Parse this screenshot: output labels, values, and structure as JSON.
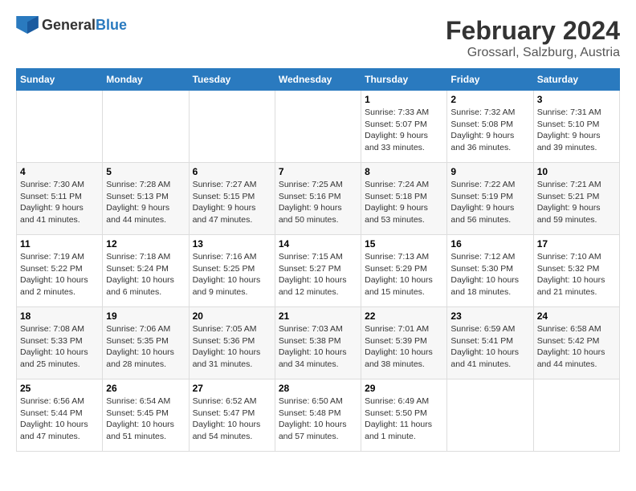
{
  "header": {
    "logo_general": "General",
    "logo_blue": "Blue",
    "title": "February 2024",
    "subtitle": "Grossarl, Salzburg, Austria"
  },
  "calendar": {
    "weekdays": [
      "Sunday",
      "Monday",
      "Tuesday",
      "Wednesday",
      "Thursday",
      "Friday",
      "Saturday"
    ],
    "weeks": [
      [
        {
          "day": "",
          "info": ""
        },
        {
          "day": "",
          "info": ""
        },
        {
          "day": "",
          "info": ""
        },
        {
          "day": "",
          "info": ""
        },
        {
          "day": "1",
          "sunrise": "Sunrise: 7:33 AM",
          "sunset": "Sunset: 5:07 PM",
          "daylight": "Daylight: 9 hours and 33 minutes."
        },
        {
          "day": "2",
          "sunrise": "Sunrise: 7:32 AM",
          "sunset": "Sunset: 5:08 PM",
          "daylight": "Daylight: 9 hours and 36 minutes."
        },
        {
          "day": "3",
          "sunrise": "Sunrise: 7:31 AM",
          "sunset": "Sunset: 5:10 PM",
          "daylight": "Daylight: 9 hours and 39 minutes."
        }
      ],
      [
        {
          "day": "4",
          "sunrise": "Sunrise: 7:30 AM",
          "sunset": "Sunset: 5:11 PM",
          "daylight": "Daylight: 9 hours and 41 minutes."
        },
        {
          "day": "5",
          "sunrise": "Sunrise: 7:28 AM",
          "sunset": "Sunset: 5:13 PM",
          "daylight": "Daylight: 9 hours and 44 minutes."
        },
        {
          "day": "6",
          "sunrise": "Sunrise: 7:27 AM",
          "sunset": "Sunset: 5:15 PM",
          "daylight": "Daylight: 9 hours and 47 minutes."
        },
        {
          "day": "7",
          "sunrise": "Sunrise: 7:25 AM",
          "sunset": "Sunset: 5:16 PM",
          "daylight": "Daylight: 9 hours and 50 minutes."
        },
        {
          "day": "8",
          "sunrise": "Sunrise: 7:24 AM",
          "sunset": "Sunset: 5:18 PM",
          "daylight": "Daylight: 9 hours and 53 minutes."
        },
        {
          "day": "9",
          "sunrise": "Sunrise: 7:22 AM",
          "sunset": "Sunset: 5:19 PM",
          "daylight": "Daylight: 9 hours and 56 minutes."
        },
        {
          "day": "10",
          "sunrise": "Sunrise: 7:21 AM",
          "sunset": "Sunset: 5:21 PM",
          "daylight": "Daylight: 9 hours and 59 minutes."
        }
      ],
      [
        {
          "day": "11",
          "sunrise": "Sunrise: 7:19 AM",
          "sunset": "Sunset: 5:22 PM",
          "daylight": "Daylight: 10 hours and 2 minutes."
        },
        {
          "day": "12",
          "sunrise": "Sunrise: 7:18 AM",
          "sunset": "Sunset: 5:24 PM",
          "daylight": "Daylight: 10 hours and 6 minutes."
        },
        {
          "day": "13",
          "sunrise": "Sunrise: 7:16 AM",
          "sunset": "Sunset: 5:25 PM",
          "daylight": "Daylight: 10 hours and 9 minutes."
        },
        {
          "day": "14",
          "sunrise": "Sunrise: 7:15 AM",
          "sunset": "Sunset: 5:27 PM",
          "daylight": "Daylight: 10 hours and 12 minutes."
        },
        {
          "day": "15",
          "sunrise": "Sunrise: 7:13 AM",
          "sunset": "Sunset: 5:29 PM",
          "daylight": "Daylight: 10 hours and 15 minutes."
        },
        {
          "day": "16",
          "sunrise": "Sunrise: 7:12 AM",
          "sunset": "Sunset: 5:30 PM",
          "daylight": "Daylight: 10 hours and 18 minutes."
        },
        {
          "day": "17",
          "sunrise": "Sunrise: 7:10 AM",
          "sunset": "Sunset: 5:32 PM",
          "daylight": "Daylight: 10 hours and 21 minutes."
        }
      ],
      [
        {
          "day": "18",
          "sunrise": "Sunrise: 7:08 AM",
          "sunset": "Sunset: 5:33 PM",
          "daylight": "Daylight: 10 hours and 25 minutes."
        },
        {
          "day": "19",
          "sunrise": "Sunrise: 7:06 AM",
          "sunset": "Sunset: 5:35 PM",
          "daylight": "Daylight: 10 hours and 28 minutes."
        },
        {
          "day": "20",
          "sunrise": "Sunrise: 7:05 AM",
          "sunset": "Sunset: 5:36 PM",
          "daylight": "Daylight: 10 hours and 31 minutes."
        },
        {
          "day": "21",
          "sunrise": "Sunrise: 7:03 AM",
          "sunset": "Sunset: 5:38 PM",
          "daylight": "Daylight: 10 hours and 34 minutes."
        },
        {
          "day": "22",
          "sunrise": "Sunrise: 7:01 AM",
          "sunset": "Sunset: 5:39 PM",
          "daylight": "Daylight: 10 hours and 38 minutes."
        },
        {
          "day": "23",
          "sunrise": "Sunrise: 6:59 AM",
          "sunset": "Sunset: 5:41 PM",
          "daylight": "Daylight: 10 hours and 41 minutes."
        },
        {
          "day": "24",
          "sunrise": "Sunrise: 6:58 AM",
          "sunset": "Sunset: 5:42 PM",
          "daylight": "Daylight: 10 hours and 44 minutes."
        }
      ],
      [
        {
          "day": "25",
          "sunrise": "Sunrise: 6:56 AM",
          "sunset": "Sunset: 5:44 PM",
          "daylight": "Daylight: 10 hours and 47 minutes."
        },
        {
          "day": "26",
          "sunrise": "Sunrise: 6:54 AM",
          "sunset": "Sunset: 5:45 PM",
          "daylight": "Daylight: 10 hours and 51 minutes."
        },
        {
          "day": "27",
          "sunrise": "Sunrise: 6:52 AM",
          "sunset": "Sunset: 5:47 PM",
          "daylight": "Daylight: 10 hours and 54 minutes."
        },
        {
          "day": "28",
          "sunrise": "Sunrise: 6:50 AM",
          "sunset": "Sunset: 5:48 PM",
          "daylight": "Daylight: 10 hours and 57 minutes."
        },
        {
          "day": "29",
          "sunrise": "Sunrise: 6:49 AM",
          "sunset": "Sunset: 5:50 PM",
          "daylight": "Daylight: 11 hours and 1 minute."
        },
        {
          "day": "",
          "info": ""
        },
        {
          "day": "",
          "info": ""
        }
      ]
    ]
  }
}
